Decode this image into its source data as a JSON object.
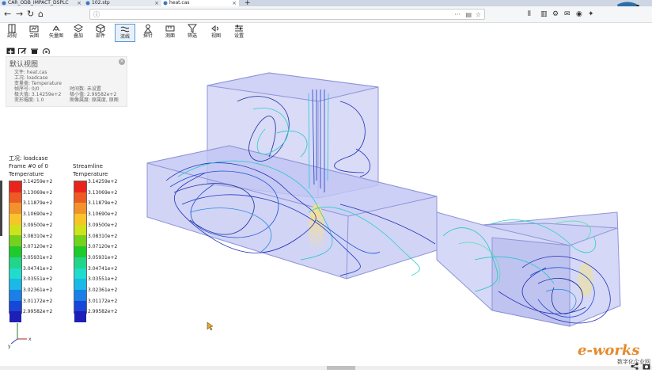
{
  "browser": {
    "tabs": [
      {
        "label": "CAR_ODB_IMPACT_DSPLC",
        "active": false
      },
      {
        "label": "102.stp",
        "active": false
      },
      {
        "label": "heat.cas",
        "active": true
      }
    ],
    "new_tab_label": "+",
    "url_info": "ⓘ",
    "url": "",
    "url_menu": "···"
  },
  "toolbar": {
    "items": [
      {
        "label": "剖视",
        "icon": "section-icon"
      },
      {
        "label": "云图",
        "icon": "contour-icon"
      },
      {
        "label": "矢量图",
        "icon": "vector-icon"
      },
      {
        "label": "叠加",
        "icon": "layers-icon"
      },
      {
        "label": "部件",
        "icon": "part-icon"
      },
      {
        "label": "流线",
        "icon": "streamline-icon",
        "active": true
      },
      {
        "label": "探针",
        "icon": "probe-icon"
      },
      {
        "label": "测面",
        "icon": "measure-icon"
      },
      {
        "label": "筛选",
        "icon": "filter-icon"
      },
      {
        "label": "视图",
        "icon": "view-icon"
      },
      {
        "label": "设置",
        "icon": "settings-icon"
      }
    ]
  },
  "info_panel": {
    "title": "默认视图",
    "file": "文件: heat.cas",
    "case": "工况: loadcase",
    "variable": "变量类: Temperature",
    "frame": "帧序号: 0/0",
    "time": "时间数: 未设置",
    "max": "极大值: 3.14259e+2",
    "min": "极小值: 2.99582e+2",
    "scale": "变形幅度: 1.0",
    "mode": "图像属度: 原属度, 原图"
  },
  "legend_left": {
    "case": "工况: loadcase",
    "frame": "Frame #0 of 0",
    "variable": "Temperature",
    "values": [
      "3.14259e+2",
      "3.13069e+2",
      "3.11879e+2",
      "3.10690e+2",
      "3.09500e+2",
      "3.08310e+2",
      "3.07120e+2",
      "3.05931e+2",
      "3.04741e+2",
      "3.03551e+2",
      "3.02361e+2",
      "3.01172e+2",
      "2.99582e+2"
    ]
  },
  "legend_right": {
    "title": "Streamline",
    "variable": "Temperature",
    "values": [
      "3.14259e+2",
      "3.13069e+2",
      "3.11879e+2",
      "3.10690e+2",
      "3.09500e+2",
      "3.08310e+2",
      "3.07120e+2",
      "3.05931e+2",
      "3.04741e+2",
      "3.03551e+2",
      "3.02361e+2",
      "3.01172e+2",
      "2.99582e+2"
    ]
  },
  "colormap": [
    "#e8241c",
    "#ee5a24",
    "#f2922c",
    "#f7c52a",
    "#cfe21b",
    "#74d11e",
    "#1fca2d",
    "#23d58b",
    "#1fdccc",
    "#1bb8e8",
    "#1a7fe6",
    "#1746d8",
    "#1e1fb4"
  ],
  "axes": {
    "z": "z",
    "y": "y",
    "x": "x"
  },
  "watermark": {
    "brand": "e-works",
    "sub": "数字化企业网"
  }
}
